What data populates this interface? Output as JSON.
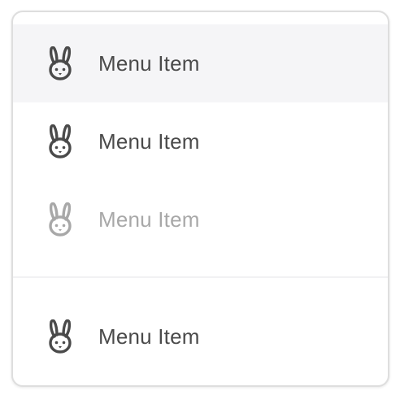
{
  "menu": {
    "items": [
      {
        "label": "Menu Item",
        "icon": "rabbit-icon",
        "state": "hovered"
      },
      {
        "label": "Menu Item",
        "icon": "rabbit-icon",
        "state": "default"
      },
      {
        "label": "Menu Item",
        "icon": "rabbit-icon",
        "state": "disabled"
      },
      {
        "label": "Menu Item",
        "icon": "rabbit-icon",
        "state": "default"
      }
    ]
  },
  "colors": {
    "hover_background": "#f5f5f7",
    "text": "#4a4a4a",
    "disabled_text": "#a8a8a8",
    "icon": "#4a4a4a",
    "disabled_icon": "#a8a8a8",
    "border": "#dedede",
    "divider": "#f1f1f3"
  }
}
